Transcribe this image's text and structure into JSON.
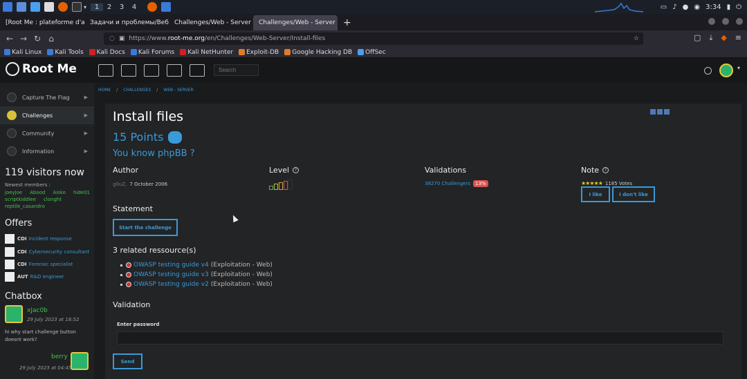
{
  "os_taskbar": {
    "workspaces": [
      "1",
      "2",
      "3",
      "4"
    ],
    "time": "3:34"
  },
  "browser": {
    "tabs": [
      {
        "label": "[Root Me : plateforme d'a"
      },
      {
        "label": "Задачи и проблемы/Веб"
      },
      {
        "label": "Challenges/Web - Server"
      },
      {
        "label": "Challenges/Web - Server"
      }
    ],
    "url_prefix": "https://www.",
    "url_domain": "root-me.org",
    "url_path": "/en/Challenges/Web-Server/Install-files",
    "bookmarks": [
      "Kali Linux",
      "Kali Tools",
      "Kali Docs",
      "Kali Forums",
      "Kali NetHunter",
      "Exploit-DB",
      "Google Hacking DB",
      "OffSec"
    ]
  },
  "site": {
    "logo_text": "Root Me",
    "search_placeholder": "Search"
  },
  "sidebar": {
    "items": [
      {
        "label": "Capture The Flag"
      },
      {
        "label": "Challenges"
      },
      {
        "label": "Community"
      },
      {
        "label": "Information"
      }
    ],
    "visitors": "119 visitors now",
    "newest_label": "Newest members :",
    "members": [
      "joeyjoe",
      "Abood",
      "Aisko",
      "hide01",
      "scriptkiddiee",
      "clonght",
      "reptile_casandro"
    ],
    "offers_title": "Offers",
    "offers": [
      {
        "kind": "CDI",
        "title": "Incident response"
      },
      {
        "kind": "CDI",
        "title": "Cybersecurity consultant"
      },
      {
        "kind": "CDI",
        "title": "Forensic specialist"
      },
      {
        "kind": "AUT",
        "title": "R&D engineer"
      }
    ],
    "chatbox_title": "Chatbox",
    "chat": [
      {
        "user": "xJac0b",
        "date": "29 July 2023 at 18:52",
        "message": "hi why start challenge button doesnt work?"
      },
      {
        "user": "berry",
        "date": "29 July 2023 at 04:45"
      }
    ]
  },
  "breadcrumb": {
    "home": "HOME",
    "challenges": "CHALLENGES",
    "section": "WEB - SERVER",
    "sep": "/"
  },
  "challenge": {
    "title": "Install files",
    "points": "15 Points",
    "subtitle": "You know phpBB ?",
    "author_h": "Author",
    "author": "g0uZ,",
    "date": "7 October 2006",
    "level_h": "Level",
    "level_value": 1,
    "level_max": 5,
    "validations_h": "Validations",
    "challengers": "38270 Challengers",
    "percent": "13%",
    "note_h": "Note",
    "stars": "★★★★★",
    "votes": "1185 Votes",
    "like": "I like",
    "dislike": "I don't like",
    "statement_h": "Statement",
    "start_btn": "Start the challenge",
    "resources_h": "3 related ressource(s)",
    "resources": [
      {
        "link": "OWASP testing guide v4",
        "category": "(Exploitation - Web)"
      },
      {
        "link": "OWASP testing guide v3",
        "category": "(Exploitation - Web)"
      },
      {
        "link": "OWASP testing guide v2",
        "category": "(Exploitation - Web)"
      }
    ],
    "validation_h": "Validation",
    "password_label": "Enter password",
    "send": "Send"
  }
}
